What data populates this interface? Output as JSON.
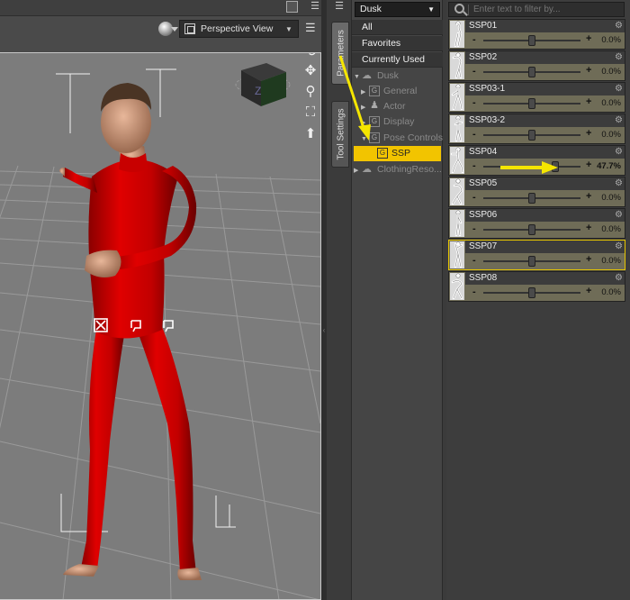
{
  "viewport": {
    "view_label": "Perspective View"
  },
  "tabs": {
    "parameters": "Parameters",
    "tool_settings": "Tool Settings"
  },
  "tree": {
    "node_dropdown": "Dusk",
    "top_items": [
      "All",
      "Favorites",
      "Currently Used"
    ],
    "items": [
      {
        "label": "Dusk"
      },
      {
        "label": "General"
      },
      {
        "label": "Actor"
      },
      {
        "label": "Display"
      },
      {
        "label": "Pose Controls"
      },
      {
        "label": "SSP"
      },
      {
        "label": "ClothingReso..."
      }
    ]
  },
  "parameters": {
    "filter_placeholder": "Enter text to filter by...",
    "items": [
      {
        "name": "SSP01",
        "value": "0.0%",
        "fraction": 0.0
      },
      {
        "name": "SSP02",
        "value": "0.0%",
        "fraction": 0.0
      },
      {
        "name": "SSP03-1",
        "value": "0.0%",
        "fraction": 0.0
      },
      {
        "name": "SSP03-2",
        "value": "0.0%",
        "fraction": 0.0
      },
      {
        "name": "SSP04",
        "value": "47.7%",
        "fraction": 0.477
      },
      {
        "name": "SSP05",
        "value": "0.0%",
        "fraction": 0.0
      },
      {
        "name": "SSP06",
        "value": "0.0%",
        "fraction": 0.0
      },
      {
        "name": "SSP07",
        "value": "0.0%",
        "fraction": 0.0
      },
      {
        "name": "SSP08",
        "value": "0.0%",
        "fraction": 0.0
      }
    ]
  },
  "colors": {
    "selection": "#f2c400",
    "annotation_arrow": "#f5e600",
    "figure": "#d40000",
    "slider_bg": "#6f6c57"
  }
}
